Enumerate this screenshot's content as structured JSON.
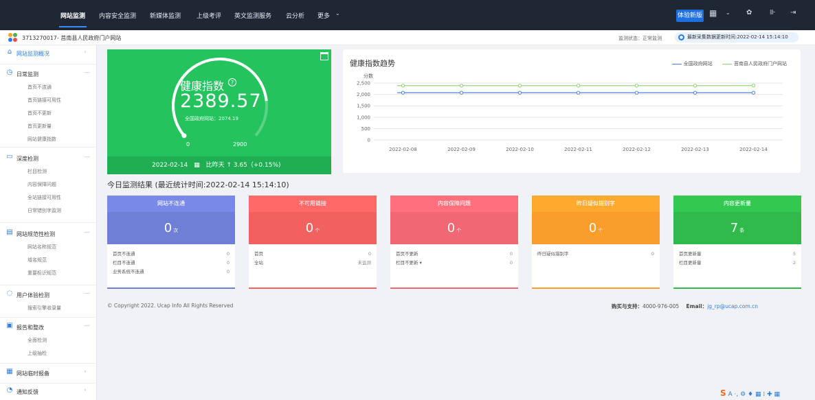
{
  "nav": {
    "items": [
      {
        "label": "网站监测"
      },
      {
        "label": "内容安全监测"
      },
      {
        "label": "新媒体监测"
      },
      {
        "label": "上级考评"
      },
      {
        "label": "英文监测服务"
      },
      {
        "label": "云分析"
      },
      {
        "label": "更多"
      }
    ],
    "trial_label": "体验新版"
  },
  "subheader": {
    "site_title": "3713270017- 莒南县人民政府门户网站",
    "monitor_status": "监测状态：正常监测",
    "latest_update": "最新采集数据更新时间:2022-02-14 15:14:10"
  },
  "sidebar": {
    "groups": [
      {
        "label": "网站监测概况",
        "items": []
      },
      {
        "label": "日常监测",
        "items": [
          "首页不连通",
          "首页链接可用性",
          "首页不更新",
          "首页更新量",
          "网站健康指数"
        ]
      },
      {
        "label": "深度检测",
        "items": [
          "栏目检测",
          "内容保障问题",
          "全站链接可用性",
          "日常错别字监测"
        ]
      },
      {
        "label": "网站规范性检测",
        "items": [
          "网站名称规范",
          "域名规范",
          "重要标识规范"
        ]
      },
      {
        "label": "用户体验检测",
        "items": [
          "搜索引擎收录量"
        ]
      },
      {
        "label": "报告和整改",
        "items": [
          "全面检测",
          "上级抽检"
        ]
      },
      {
        "label": "网站临时报备",
        "items": []
      },
      {
        "label": "通知反馈",
        "items": []
      }
    ]
  },
  "health": {
    "title": "健康指数",
    "value": "2389.57",
    "national": "全国政府网站：2074.19",
    "gauge_min": "0",
    "gauge_max": "2900",
    "gauge_level": 0.824,
    "date": "2022-02-14",
    "compare": "比昨天 ↑ 3.65（+0.15%)"
  },
  "trend": {
    "title": "健康指数趋势"
  },
  "chart_data": {
    "type": "line",
    "title": "健康指数趋势",
    "ylabel": "分数",
    "xlabel": "",
    "ylim": [
      0,
      2500
    ],
    "yticks": [
      "0",
      "500",
      "1,000",
      "1,500",
      "2,000",
      "2,500"
    ],
    "categories": [
      "2022-02-08",
      "2022-02-09",
      "2022-02-10",
      "2022-02-11",
      "2022-02-12",
      "2022-02-13",
      "2022-02-14"
    ],
    "series": [
      {
        "name": "全国政府网站",
        "color": "#4a7fd6",
        "values": [
          2074,
          2074,
          2074,
          2074,
          2074,
          2074,
          2074
        ]
      },
      {
        "name": "莒南县人民政府门户网站",
        "color": "#8ed36f",
        "values": [
          2386,
          2386,
          2386,
          2386,
          2386,
          2386,
          2390
        ]
      }
    ],
    "grid": true,
    "legend": "top-right"
  },
  "results": {
    "title": "今日监测结果 (最近统计时间:2022-02-14 15:14:10)",
    "cards": [
      {
        "header": "网站不连通",
        "value": "0",
        "unit": "次",
        "color": "#6f7fd6",
        "rows": [
          [
            "首页不连通",
            "0"
          ],
          [
            "栏目不连通",
            "0"
          ],
          [
            "业务系统不连通",
            "0"
          ]
        ]
      },
      {
        "header": "不可用链接",
        "value": "0",
        "unit": "个",
        "color": "#f16160",
        "rows": [
          [
            "首页",
            "0"
          ],
          [
            "全站",
            "未监测"
          ]
        ]
      },
      {
        "header": "内容保障问题",
        "value": "0",
        "unit": "个",
        "color": "#f06873",
        "rows": [
          [
            "首页不更新",
            "0"
          ],
          [
            "栏目不更新 ▾",
            "0"
          ]
        ]
      },
      {
        "header": "昨日疑似错别字",
        "value": "0",
        "unit": "个",
        "color": "#f99d2b",
        "rows": [
          [
            "昨日疑似错别字",
            "0"
          ]
        ]
      },
      {
        "header": "内容更新量",
        "value": "7",
        "unit": "条",
        "color": "#2fba4b",
        "rows": [
          [
            "首页更新量",
            "5"
          ],
          [
            "栏目更新量",
            "2"
          ]
        ]
      }
    ]
  },
  "footer": {
    "copyright": "© Copyright 2022. Ucap Info All Rights Reserved",
    "support_label": "购买与支持：",
    "support_phone": "4000-976-005",
    "email_label": "Email：",
    "email": "jg_rp@ucap.com.cn"
  }
}
